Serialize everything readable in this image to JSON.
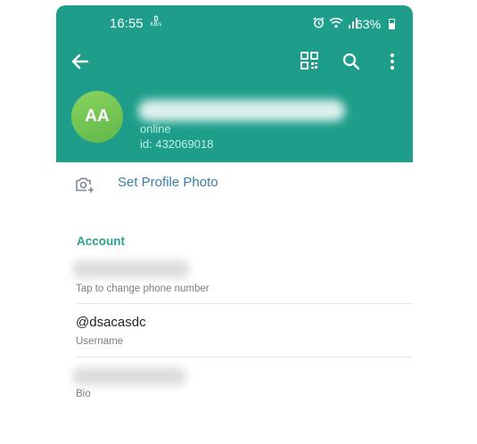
{
  "status_bar": {
    "time": "16:55",
    "net_speed_value": "0",
    "net_speed_unit": "KB/s",
    "battery": "63%",
    "battery_level": 0.63
  },
  "toolbar": {
    "back_icon": "arrow-left-icon",
    "qr_icon": "qr-code-icon",
    "search_icon": "search-icon",
    "more_icon": "more-vertical-icon"
  },
  "profile": {
    "avatar_initials": "AA",
    "status": "online",
    "id": "id: 432069018"
  },
  "set_photo": {
    "label": "Set Profile Photo",
    "icon": "camera-add-icon"
  },
  "account": {
    "title": "Account",
    "phone_hint": "Tap to change phone number",
    "username": "@dsacasdc",
    "username_label": "Username",
    "bio_label": "Bio"
  },
  "colors": {
    "header": "#1e9e8a",
    "accent": "#2d9f8e",
    "link": "#3a7fa8",
    "avatar": "#6fc24f"
  }
}
